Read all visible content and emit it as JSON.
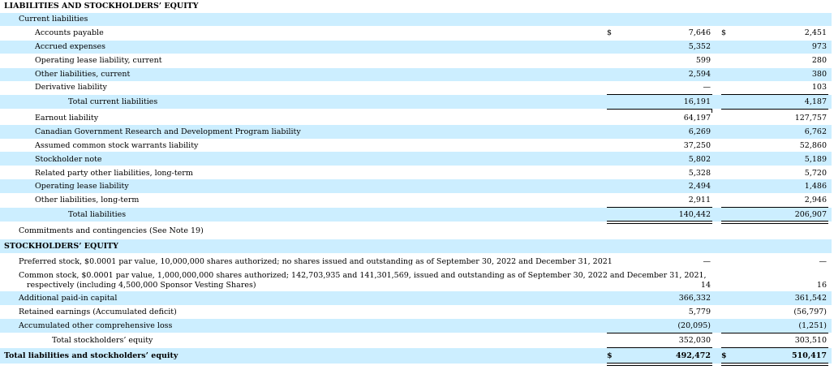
{
  "header": {
    "title": "LIABILITIES AND STOCKHOLDERS’ EQUITY"
  },
  "current": {
    "heading": "Current liabilities",
    "rows": [
      {
        "label": "Accounts payable",
        "dollar1": "$",
        "v1": "7,646",
        "dollar2": "$",
        "v2": "2,451"
      },
      {
        "label": "Accrued expenses",
        "v1": "5,352",
        "v2": "973"
      },
      {
        "label": "Operating lease liability, current",
        "v1": "599",
        "v2": "280"
      },
      {
        "label": "Other liabilities, current",
        "v1": "2,594",
        "v2": "380"
      },
      {
        "label": "Derivative liability",
        "v1": "—",
        "v2": "103"
      }
    ],
    "total": {
      "label": "Total current liabilities",
      "v1": "16,191",
      "v2": "4,187"
    }
  },
  "noncurrent": {
    "rows": [
      {
        "label": "Earnout liability",
        "v1": "64,197",
        "v2": "127,757"
      },
      {
        "label": "Canadian Government Research and Development Program liability",
        "v1": "6,269",
        "v2": "6,762"
      },
      {
        "label": "Assumed common stock warrants liability",
        "v1": "37,250",
        "v2": "52,860"
      },
      {
        "label": "Stockholder note",
        "v1": "5,802",
        "v2": "5,189"
      },
      {
        "label": "Related party other liabilities, long-term",
        "v1": "5,328",
        "v2": "5,720"
      },
      {
        "label": "Operating lease liability",
        "v1": "2,494",
        "v2": "1,486"
      },
      {
        "label": "Other liabilities, long-term",
        "v1": "2,911",
        "v2": "2,946"
      }
    ],
    "total": {
      "label": "Total liabilities",
      "v1": "140,442",
      "v2": "206,907"
    }
  },
  "commitments": {
    "label": "Commitments and contingencies (See Note 19)"
  },
  "equity": {
    "heading": "STOCKHOLDERS’ EQUITY",
    "preferred": {
      "label": "Preferred stock, $0.0001 par value, 10,000,000 shares authorized; no shares issued and outstanding as of September 30, 2022 and December 31, 2021",
      "v1": "—",
      "v2": "—"
    },
    "common": {
      "label_line1": "Common stock, $0.0001 par value, 1,000,000,000 shares authorized; 142,703,935 and 141,301,569, issued and outstanding as of September 30, 2022 and December 31, 2021,",
      "label_line2": "respectively (including 4,500,000 Sponsor Vesting Shares)",
      "v1": "14",
      "v2": "16"
    },
    "rows": [
      {
        "label": "Additional paid-in capital",
        "v1": "366,332",
        "v2": "361,542"
      },
      {
        "label": "Retained earnings (Accumulated deficit)",
        "v1": "5,779",
        "v2": "(56,797)"
      },
      {
        "label": "Accumulated other comprehensive loss",
        "v1": "(20,095)",
        "v2": "(1,251)"
      }
    ],
    "total": {
      "label": "Total stockholders’ equity",
      "v1": "352,030",
      "v2": "303,510"
    }
  },
  "grand_total": {
    "label": "Total liabilities and stockholders’ equity",
    "dollar1": "$",
    "v1": "492,472",
    "dollar2": "$",
    "v2": "510,417"
  }
}
